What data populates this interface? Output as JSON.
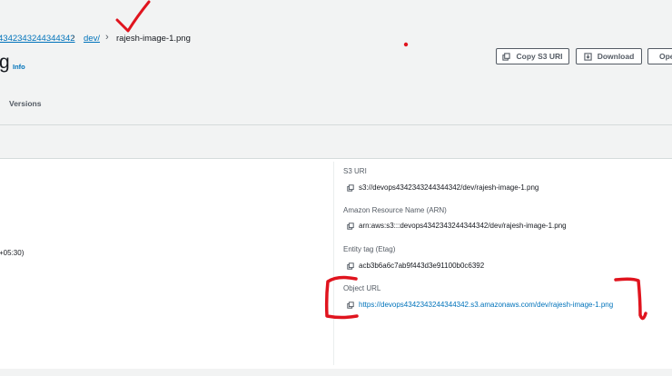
{
  "breadcrumb": {
    "bucket": "4342343244344342",
    "folder": "dev/",
    "object": "rajesh-image-1.png"
  },
  "header": {
    "title_fragment": "g",
    "info_label": "Info"
  },
  "actions": {
    "copy_uri": "Copy S3 URI",
    "download": "Download",
    "open_partial": "Ope"
  },
  "tabs": {
    "versions": "Versions"
  },
  "properties": {
    "left_partial_value": "+05:30)",
    "s3_uri_label": "S3 URI",
    "s3_uri_value": "s3://devops4342343244344342/dev/rajesh-image-1.png",
    "arn_label": "Amazon Resource Name (ARN)",
    "arn_value": "arn:aws:s3:::devops4342343244344342/dev/rajesh-image-1.png",
    "etag_label": "Entity tag (Etag)",
    "etag_value": "acb3b6a6c7ab9f443d3e91100b0c6392",
    "object_url_label": "Object URL",
    "object_url_value": "https://devops4342343244344342.s3.amazonaws.com/dev/rajesh-image-1.png"
  },
  "colors": {
    "link": "#0073bb",
    "annotation": "#e0141e",
    "background": "#f2f3f3"
  },
  "icons": [
    "copy-icon",
    "download-icon",
    "chevron-right-icon"
  ]
}
